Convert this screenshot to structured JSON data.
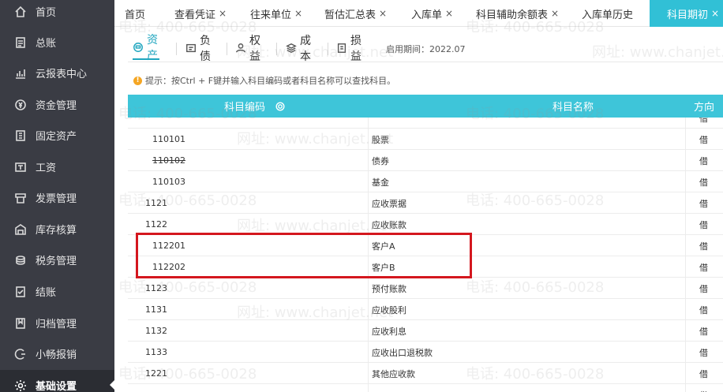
{
  "sidebar": {
    "items": [
      {
        "label": "首页",
        "icon": "home-icon"
      },
      {
        "label": "总账",
        "icon": "ledger-icon"
      },
      {
        "label": "云报表中心",
        "icon": "chart-icon"
      },
      {
        "label": "资金管理",
        "icon": "money-icon"
      },
      {
        "label": "固定资产",
        "icon": "asset-icon"
      },
      {
        "label": "工资",
        "icon": "salary-icon"
      },
      {
        "label": "发票管理",
        "icon": "invoice-icon"
      },
      {
        "label": "库存核算",
        "icon": "warehouse-icon"
      },
      {
        "label": "税务管理",
        "icon": "tax-icon"
      },
      {
        "label": "结账",
        "icon": "checkout-icon"
      },
      {
        "label": "归档管理",
        "icon": "archive-icon"
      },
      {
        "label": "小畅报销",
        "icon": "reimburse-icon"
      },
      {
        "label": "基础设置",
        "icon": "settings-icon",
        "active": true
      }
    ]
  },
  "tabs": [
    {
      "label": "首页",
      "closable": false
    },
    {
      "label": "查看凭证",
      "closable": true
    },
    {
      "label": "往来单位",
      "closable": true
    },
    {
      "label": "暂估汇总表",
      "closable": true
    },
    {
      "label": "入库单",
      "closable": true
    },
    {
      "label": "科目辅助余额表",
      "closable": true
    },
    {
      "label": "入库单历史",
      "closable": false
    },
    {
      "label": "科目期初",
      "closable": true,
      "active": true
    }
  ],
  "close_glyph": "×",
  "categories": [
    {
      "label": "资产",
      "icon": "asset-cat-icon",
      "active": true
    },
    {
      "label": "负债",
      "icon": "liability-cat-icon"
    },
    {
      "label": "权益",
      "icon": "equity-cat-icon"
    },
    {
      "label": "成本",
      "icon": "cost-cat-icon"
    },
    {
      "label": "损益",
      "icon": "profit-loss-cat-icon"
    }
  ],
  "enable_date": "启用期间：2022.07",
  "hint": {
    "icon": "!",
    "text": "提示：按Ctrl + F键并输入科目编码或者科目名称可以查找科目。"
  },
  "table": {
    "columns": [
      "科目编码",
      "科目名称",
      "方向"
    ],
    "rows": [
      {
        "code": "",
        "name": "",
        "dir": "借"
      },
      {
        "code": "110101",
        "name": "股票",
        "dir": "借",
        "indent": true
      },
      {
        "code": "110102",
        "name": "债券",
        "dir": "借",
        "indent": true,
        "strike": true
      },
      {
        "code": "110103",
        "name": "基金",
        "dir": "借",
        "indent": true
      },
      {
        "code": "1121",
        "name": "应收票据",
        "dir": "借"
      },
      {
        "code": "1122",
        "name": "应收账款",
        "dir": "借"
      },
      {
        "code": "112201",
        "name": "客户A",
        "dir": "借",
        "indent": true
      },
      {
        "code": "112202",
        "name": "客户B",
        "dir": "借",
        "indent": true
      },
      {
        "code": "1123",
        "name": "预付账款",
        "dir": "借"
      },
      {
        "code": "1131",
        "name": "应收股利",
        "dir": "借"
      },
      {
        "code": "1132",
        "name": "应收利息",
        "dir": "借"
      },
      {
        "code": "1133",
        "name": "应收出口退税款",
        "dir": "借"
      },
      {
        "code": "1221",
        "name": "其他应收款",
        "dir": "借"
      },
      {
        "code": "",
        "name": "",
        "dir": "借"
      }
    ]
  },
  "watermark": {
    "phone": "电话: 400-665-0028",
    "site": "网址: www.chanjet.net"
  }
}
